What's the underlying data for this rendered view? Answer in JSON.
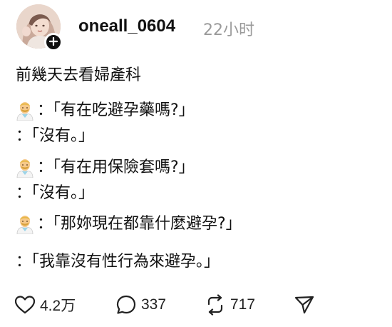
{
  "post": {
    "author": {
      "username": "oneall_0604",
      "avatar_icon": "avatar-photo",
      "follow_icon": "plus-icon"
    },
    "timestamp": "22小时",
    "lines": [
      {
        "speaker": "",
        "text": "前幾天去看婦產科"
      },
      {
        "speaker": "doctor-emoji",
        "text": "：「有在吃避孕藥嗎?」"
      },
      {
        "speaker": "",
        "text": "：「沒有。」"
      },
      {
        "speaker": "doctor-emoji",
        "text": "：「有在用保險套嗎?」"
      },
      {
        "speaker": "",
        "text": "：「沒有。」"
      },
      {
        "speaker": "doctor-emoji",
        "text": "：「那妳現在都靠什麼避孕?」"
      },
      {
        "speaker": "",
        "text": "：「我靠沒有性行為來避孕。」"
      }
    ],
    "actions": {
      "like": {
        "icon": "heart-icon",
        "count": "4.2万"
      },
      "comment": {
        "icon": "comment-icon",
        "count": "337"
      },
      "repost": {
        "icon": "repost-icon",
        "count": "717"
      },
      "share": {
        "icon": "send-icon"
      }
    }
  }
}
